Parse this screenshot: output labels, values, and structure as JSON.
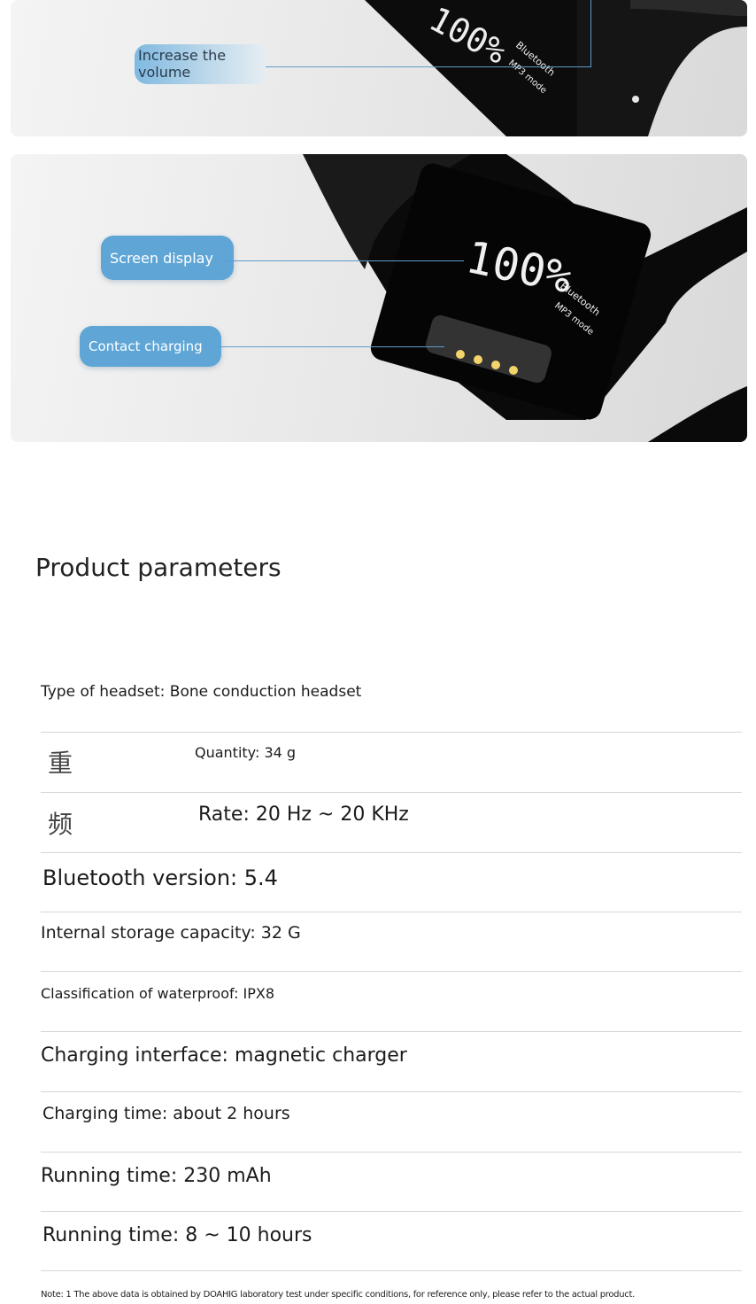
{
  "callouts": {
    "increase_volume": "Increase the volume",
    "screen_display": "Screen display",
    "contact_charging": "Contact charging"
  },
  "device_screen": {
    "percent_top": "100%",
    "percent": "100%",
    "mode_line1": "Bluetooth",
    "mode_line2": "MP3 mode"
  },
  "params": {
    "title": "Product parameters",
    "rows": [
      {
        "text": "Type of headset: Bone conduction headset"
      },
      {
        "prefix": "重",
        "text": "Quantity: 34 g"
      },
      {
        "prefix": "频",
        "text": "Rate: 20 Hz ~ 20 KHz"
      },
      {
        "text": "Bluetooth version: 5.4"
      },
      {
        "text": "Internal storage capacity: 32 G"
      },
      {
        "text": "Classification of waterproof: IPX8"
      },
      {
        "text": "Charging interface: magnetic charger"
      },
      {
        "text": "Charging time: about 2 hours"
      },
      {
        "text": "Running time: 230 mAh"
      },
      {
        "text": "Running time: 8 ~ 10 hours"
      }
    ]
  },
  "note": "Note: 1 The above data is obtained by DOAHIG laboratory test under specific conditions, for reference only, please refer to the actual product."
}
